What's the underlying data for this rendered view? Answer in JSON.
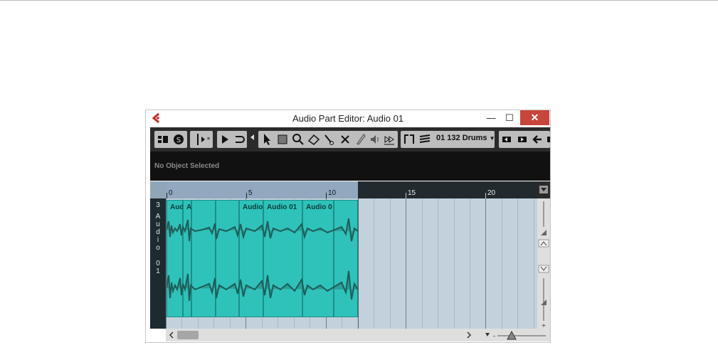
{
  "window": {
    "title": "Audio Part Editor: Audio 01",
    "minimize_glyph": "—",
    "maximize_glyph": "☐",
    "close_glyph": "✕"
  },
  "toolbar": {
    "drum_label": "01 132 Drums",
    "icons": [
      "inspector-icon",
      "solo-icon",
      "autoscroll-icon",
      "play-icon",
      "loop-icon",
      "select-tool-icon",
      "range-tool-icon",
      "zoom-tool-icon",
      "erase-tool-icon",
      "split-tool-icon",
      "mute-tool-icon",
      "draw-tool-icon",
      "speaker-icon",
      "time-warp-icon",
      "snap-icon",
      "stack-icon"
    ]
  },
  "infobar": {
    "text": "No Object Selected"
  },
  "track": {
    "label_chars": [
      "3",
      "A",
      "u",
      "d",
      "i",
      "o",
      "",
      "0",
      "1"
    ]
  },
  "ruler": {
    "labels": [
      "0",
      "5",
      "10",
      "15",
      "20"
    ]
  },
  "events": [
    "Aud",
    "A",
    "",
    "",
    "Audio",
    "Audio 01",
    "Audio 0",
    ""
  ],
  "colors": {
    "event_fill": "#2fc2ba",
    "grid_bg": "#c3d1dc",
    "ruler_selected": "#91a8bf",
    "close_button": "#c7453b"
  }
}
